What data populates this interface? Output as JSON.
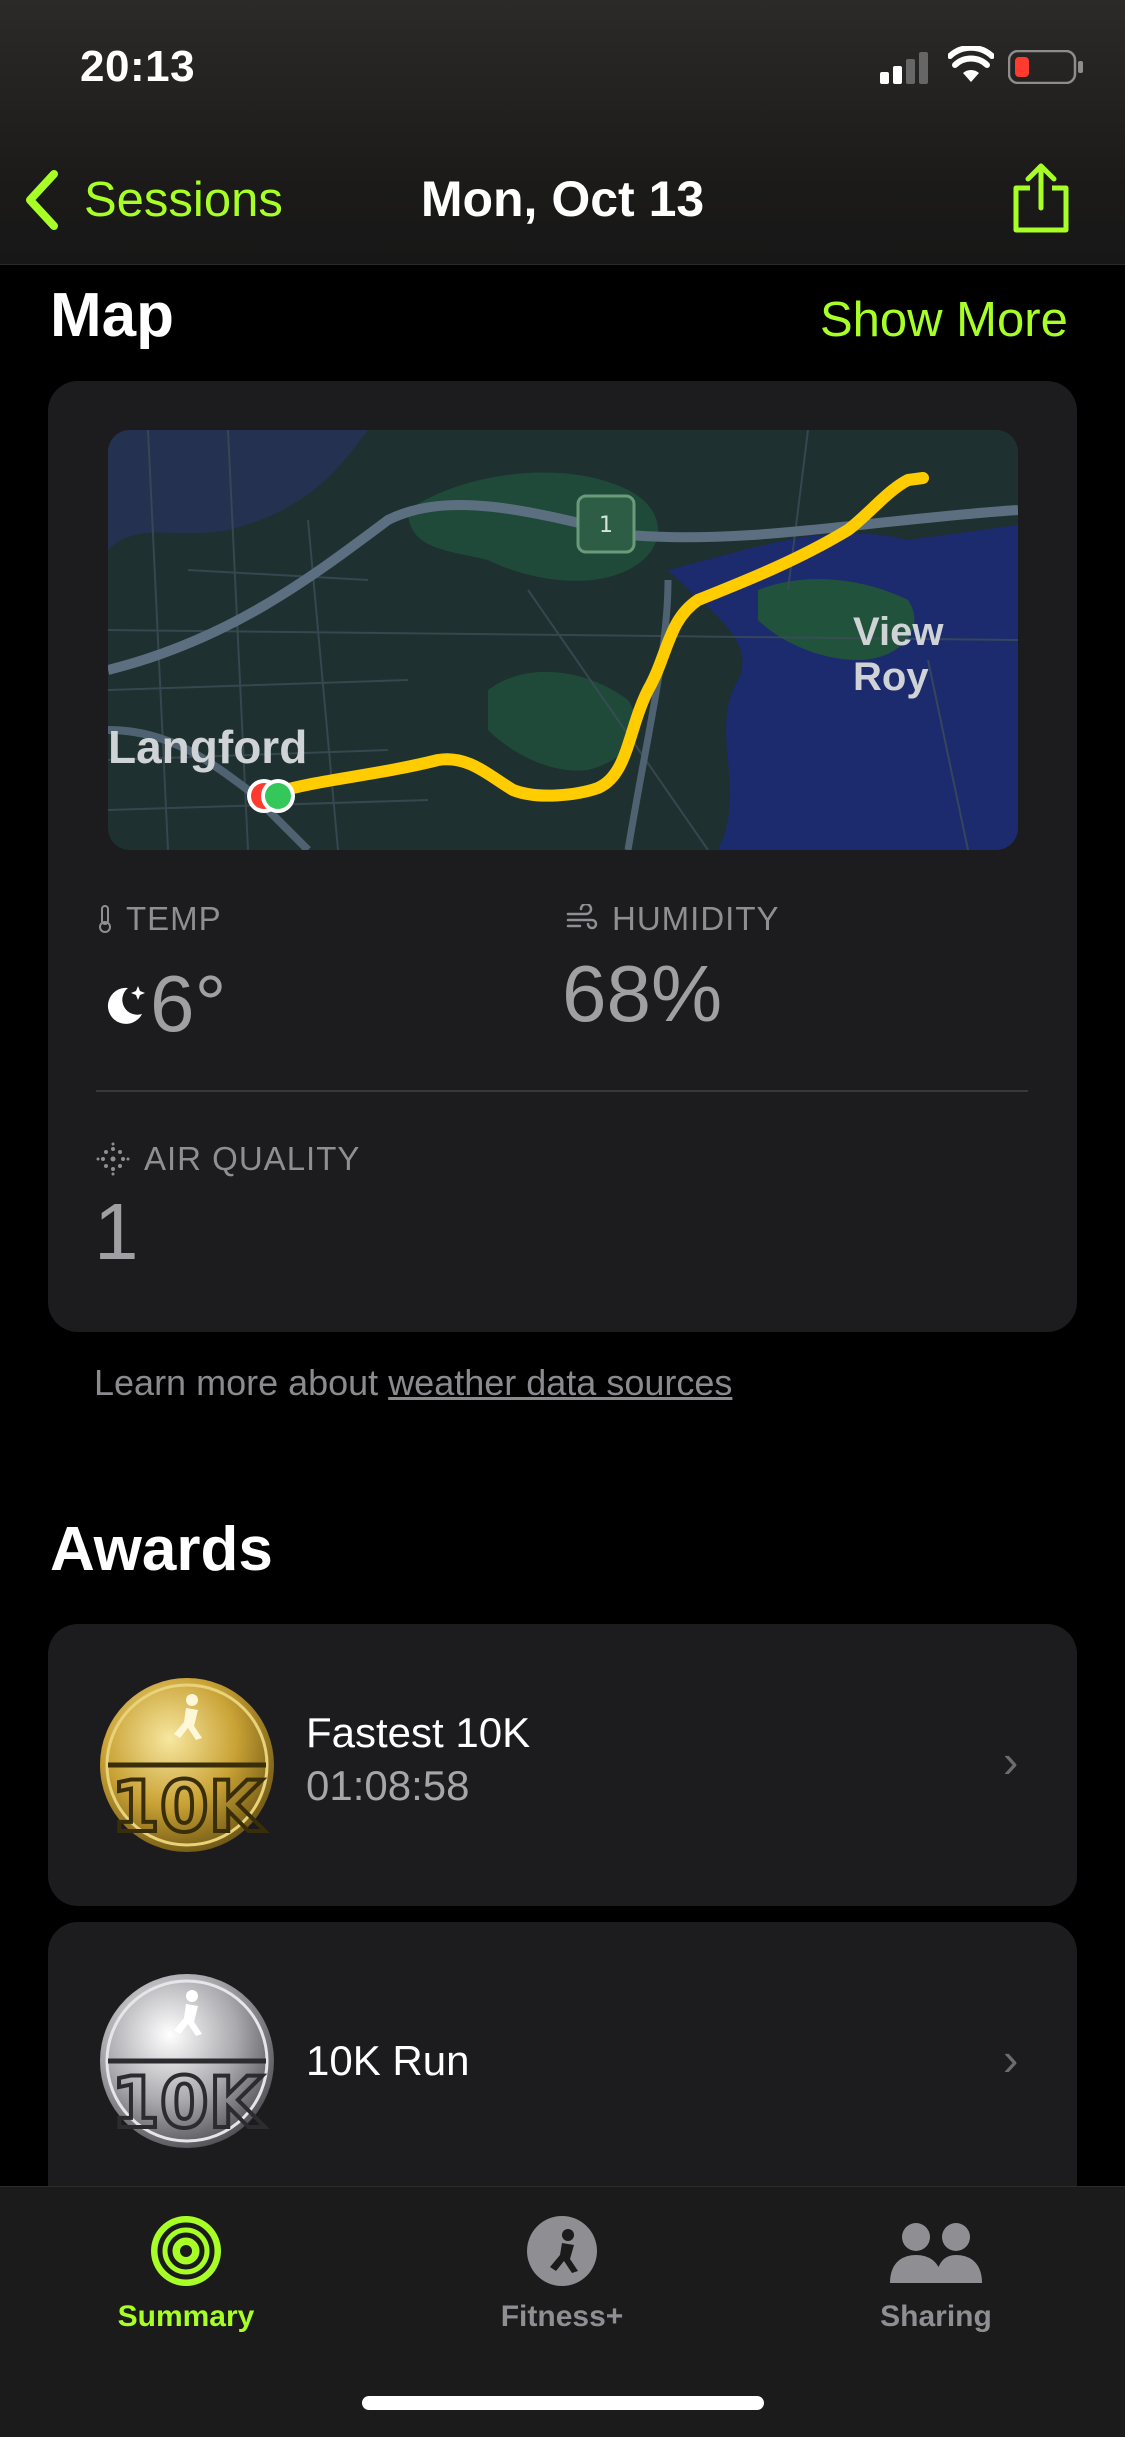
{
  "status_bar": {
    "time": "20:13"
  },
  "nav": {
    "back_label": "Sessions",
    "title": "Mon, Oct 13"
  },
  "map_section": {
    "title": "Map",
    "show_more": "Show More",
    "labels": {
      "place_left": "Langford",
      "place_right": "View Roy",
      "route_shield": "1"
    }
  },
  "weather": {
    "temp_label": "TEMP",
    "temp_value": "6°",
    "humidity_label": "HUMIDITY",
    "humidity_value": "68%",
    "air_label": "AIR QUALITY",
    "air_value": "1"
  },
  "note": {
    "prefix": "Learn more about ",
    "link": "weather data sources"
  },
  "awards": {
    "title": "Awards",
    "items": [
      {
        "title": "Fastest 10K",
        "subtitle": "01:08:58",
        "medal": "gold"
      },
      {
        "title": "10K Run",
        "subtitle": "",
        "medal": "silver"
      }
    ]
  },
  "tabbar": {
    "items": [
      {
        "label": "Summary",
        "active": true,
        "color": "#a8ff26"
      },
      {
        "label": "Fitness+",
        "active": false,
        "color": "#8e8e93"
      },
      {
        "label": "Sharing",
        "active": false,
        "color": "#8e8e93"
      }
    ]
  },
  "colors": {
    "accent": "#a8ff26",
    "route": "#ffcc00",
    "card": "#1c1c1e"
  }
}
